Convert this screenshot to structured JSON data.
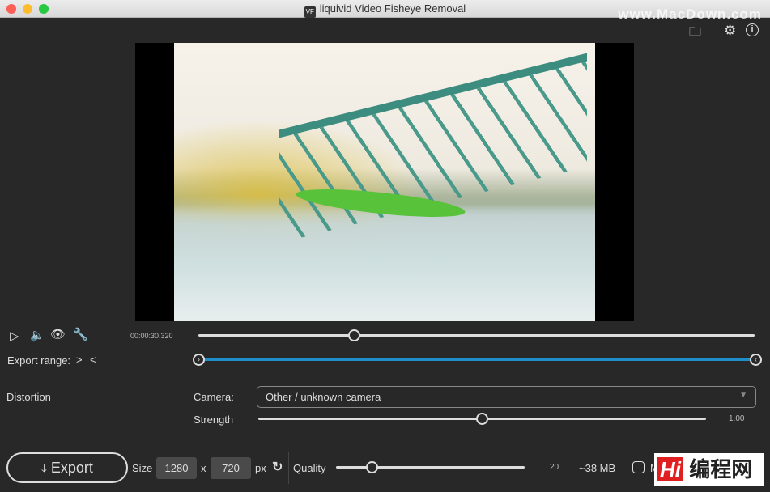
{
  "window": {
    "title": "liquivid Video Fisheye Removal",
    "app_icon": "VF"
  },
  "watermarks": {
    "top": "www.MacDown.com",
    "bottom": "编程网"
  },
  "toolbar": {
    "icons": [
      "folder-icon",
      "gear-icon",
      "info-icon"
    ]
  },
  "player": {
    "timecode": "00:00:30.320",
    "position_fraction": 0.28
  },
  "export_range": {
    "label": "Export range:",
    "start_icon": ">",
    "end_icon": "<",
    "start_fraction": 0,
    "end_fraction": 1,
    "accent": "#1f8dc9"
  },
  "distortion": {
    "section": "Distortion",
    "camera_label": "Camera:",
    "camera_value": "Other / unknown camera",
    "strength_label": "Strength",
    "strength_value": "1.00",
    "strength_fraction": 0.5
  },
  "export": {
    "button": "Export",
    "size_label": "Size",
    "width": "1280",
    "x": "x",
    "height": "720",
    "px": "px",
    "quality_label": "Quality",
    "quality_value": "20",
    "quality_fraction": 0.19,
    "estimate": "~38 MB",
    "checkbox_label": "M"
  }
}
